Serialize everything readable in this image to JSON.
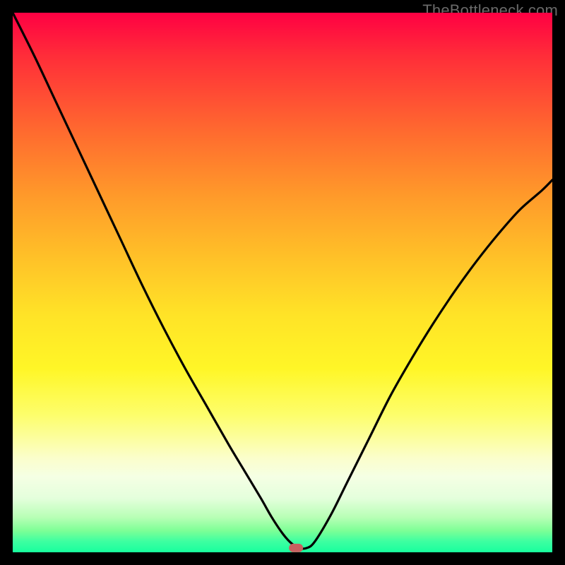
{
  "watermark": "TheBottleneck.com",
  "marker": {
    "x_frac": 0.525,
    "y_frac": 0.992
  },
  "chart_data": {
    "type": "line",
    "title": "",
    "xlabel": "",
    "ylabel": "",
    "xlim": [
      0,
      1
    ],
    "ylim": [
      0,
      1
    ],
    "series": [
      {
        "name": "curve",
        "x": [
          0.0,
          0.04,
          0.08,
          0.12,
          0.16,
          0.2,
          0.24,
          0.28,
          0.32,
          0.36,
          0.4,
          0.43,
          0.46,
          0.48,
          0.5,
          0.515,
          0.53,
          0.545,
          0.56,
          0.59,
          0.62,
          0.66,
          0.7,
          0.74,
          0.78,
          0.82,
          0.86,
          0.9,
          0.94,
          0.98,
          1.0
        ],
        "y": [
          1.0,
          0.92,
          0.835,
          0.75,
          0.665,
          0.58,
          0.495,
          0.415,
          0.34,
          0.27,
          0.2,
          0.15,
          0.1,
          0.065,
          0.035,
          0.018,
          0.008,
          0.008,
          0.02,
          0.07,
          0.13,
          0.21,
          0.29,
          0.36,
          0.425,
          0.485,
          0.54,
          0.59,
          0.635,
          0.67,
          0.69
        ]
      }
    ],
    "annotations": [
      {
        "name": "min-marker",
        "x": 0.525,
        "y": 0.008
      }
    ]
  }
}
